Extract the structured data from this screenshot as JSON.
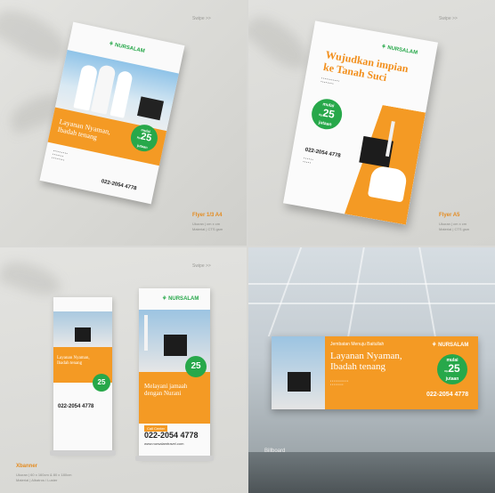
{
  "brand": {
    "name": "NURSALAM",
    "orange": "#f28f1c",
    "green": "#27a84a"
  },
  "panel1": {
    "swipe": "Swipe >>",
    "caption": "Flyer 1/3 A4",
    "sub": "Ukuran | cm x cm\nMaterial | CTS gsm",
    "flyer": {
      "title_line1": "Layanan Nyaman,",
      "title_line2": "Ibadah tenang",
      "badge_top": "mulai",
      "badge_rp": "Rp",
      "badge_num": "25",
      "badge_unit": "jutaan",
      "phone": "022-2054 4778"
    }
  },
  "panel2": {
    "swipe": "Swipe >>",
    "caption": "Flyer A5",
    "sub": "Ukuran | cm x cm\nMaterial | CTS gsm",
    "flyer": {
      "title_line1": "Wujudkan impian",
      "title_line2": "ke Tanah Suci",
      "badge_top": "mulai",
      "badge_rp": "Rp",
      "badge_num": "25",
      "badge_unit": "jutaan",
      "phone": "022-2054 4778"
    }
  },
  "panel3": {
    "swipe": "Swipe >>",
    "caption": "Xbanner",
    "sub": "Ukuran | 60 x 160cm & 80 x 180cm\nMaterial | Albatros / Luster",
    "banner1": {
      "title_line1": "Layanan Nyaman,",
      "title_line2": "Ibadah tenang",
      "badge_num": "25",
      "phone": "022-2054 4778"
    },
    "banner2": {
      "title_line1": "Melayani jamaah",
      "title_line2": "dengan Nurani",
      "badge_num": "25",
      "call_label": "Call Center",
      "phone": "022-2054 4778",
      "web": "www.nursalamtravel.com"
    }
  },
  "panel4": {
    "caption": "Billboard",
    "billboard": {
      "kicker": "Jembatan Menuju Baitullah",
      "title_line1": "Layanan Nyaman,",
      "title_line2": "Ibadah tenang",
      "badge_top": "mulai",
      "badge_rp": "Rp",
      "badge_num": "25",
      "badge_unit": "jutaan",
      "phone": "022-2054 4778"
    }
  }
}
